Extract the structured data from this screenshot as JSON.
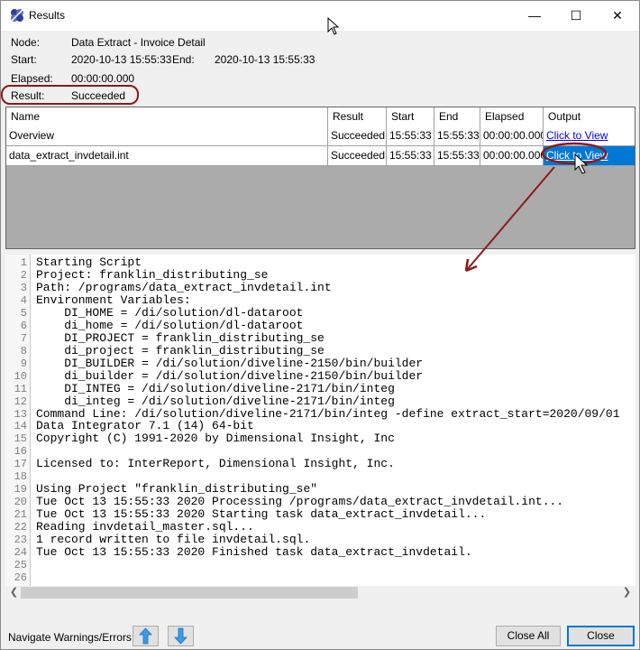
{
  "window": {
    "title": "Results",
    "minimize": "—",
    "maximize": "☐",
    "close": "✕"
  },
  "info": {
    "node_label": "Node:",
    "node_value": "Data Extract - Invoice Detail",
    "start_label": "Start:",
    "start_value": "2020-10-13 15:55:33",
    "end_label": "End:",
    "end_value": "2020-10-13 15:55:33",
    "elapsed_label": "Elapsed:",
    "elapsed_value": "00:00:00.000",
    "result_label": "Result:",
    "result_value": "Succeeded"
  },
  "grid": {
    "columns": [
      "Name",
      "Result",
      "Start",
      "End",
      "Elapsed",
      "Output"
    ],
    "rows": [
      {
        "name": "Overview",
        "result": "Succeeded",
        "start": "15:55:33",
        "end": "15:55:33",
        "elapsed": "00:00:00.000",
        "output": "Click to View",
        "selected": false
      },
      {
        "name": "data_extract_invdetail.int",
        "result": "Succeeded",
        "start": "15:55:33",
        "end": "15:55:33",
        "elapsed": "00:00:00.000",
        "output": "Click to View",
        "selected": true
      }
    ]
  },
  "log": {
    "lines": [
      "Starting Script",
      "Project: franklin_distributing_se",
      "Path: /programs/data_extract_invdetail.int",
      "Environment Variables:",
      "    DI_HOME = /di/solution/dl-dataroot",
      "    di_home = /di/solution/dl-dataroot",
      "    DI_PROJECT = franklin_distributing_se",
      "    di_project = franklin_distributing_se",
      "    DI_BUILDER = /di/solution/diveline-2150/bin/builder",
      "    di_builder = /di/solution/diveline-2150/bin/builder",
      "    DI_INTEG = /di/solution/diveline-2171/bin/integ",
      "    di_integ = /di/solution/diveline-2171/bin/integ",
      "Command Line: /di/solution/diveline-2171/bin/integ -define extract_start=2020/09/01",
      "Data Integrator 7.1 (14) 64-bit",
      "Copyright (C) 1991-2020 by Dimensional Insight, Inc",
      "",
      "Licensed to: InterReport, Dimensional Insight, Inc.",
      "",
      "Using Project \"franklin_distributing_se\"",
      "Tue Oct 13 15:55:33 2020 Processing /programs/data_extract_invdetail.int...",
      "Tue Oct 13 15:55:33 2020 Starting task data_extract_invdetail...",
      "Reading invdetail_master.sql...",
      "1 record written to file invdetail.sql.",
      "Tue Oct 13 15:55:33 2020 Finished task data_extract_invdetail.",
      "",
      ""
    ]
  },
  "footer": {
    "nav_label": "Navigate Warnings/Errors:",
    "close_all": "Close All",
    "close": "Close"
  },
  "colors": {
    "selection": "#0078d7",
    "annotation": "#8b1a1a",
    "link": "#0000ee"
  }
}
